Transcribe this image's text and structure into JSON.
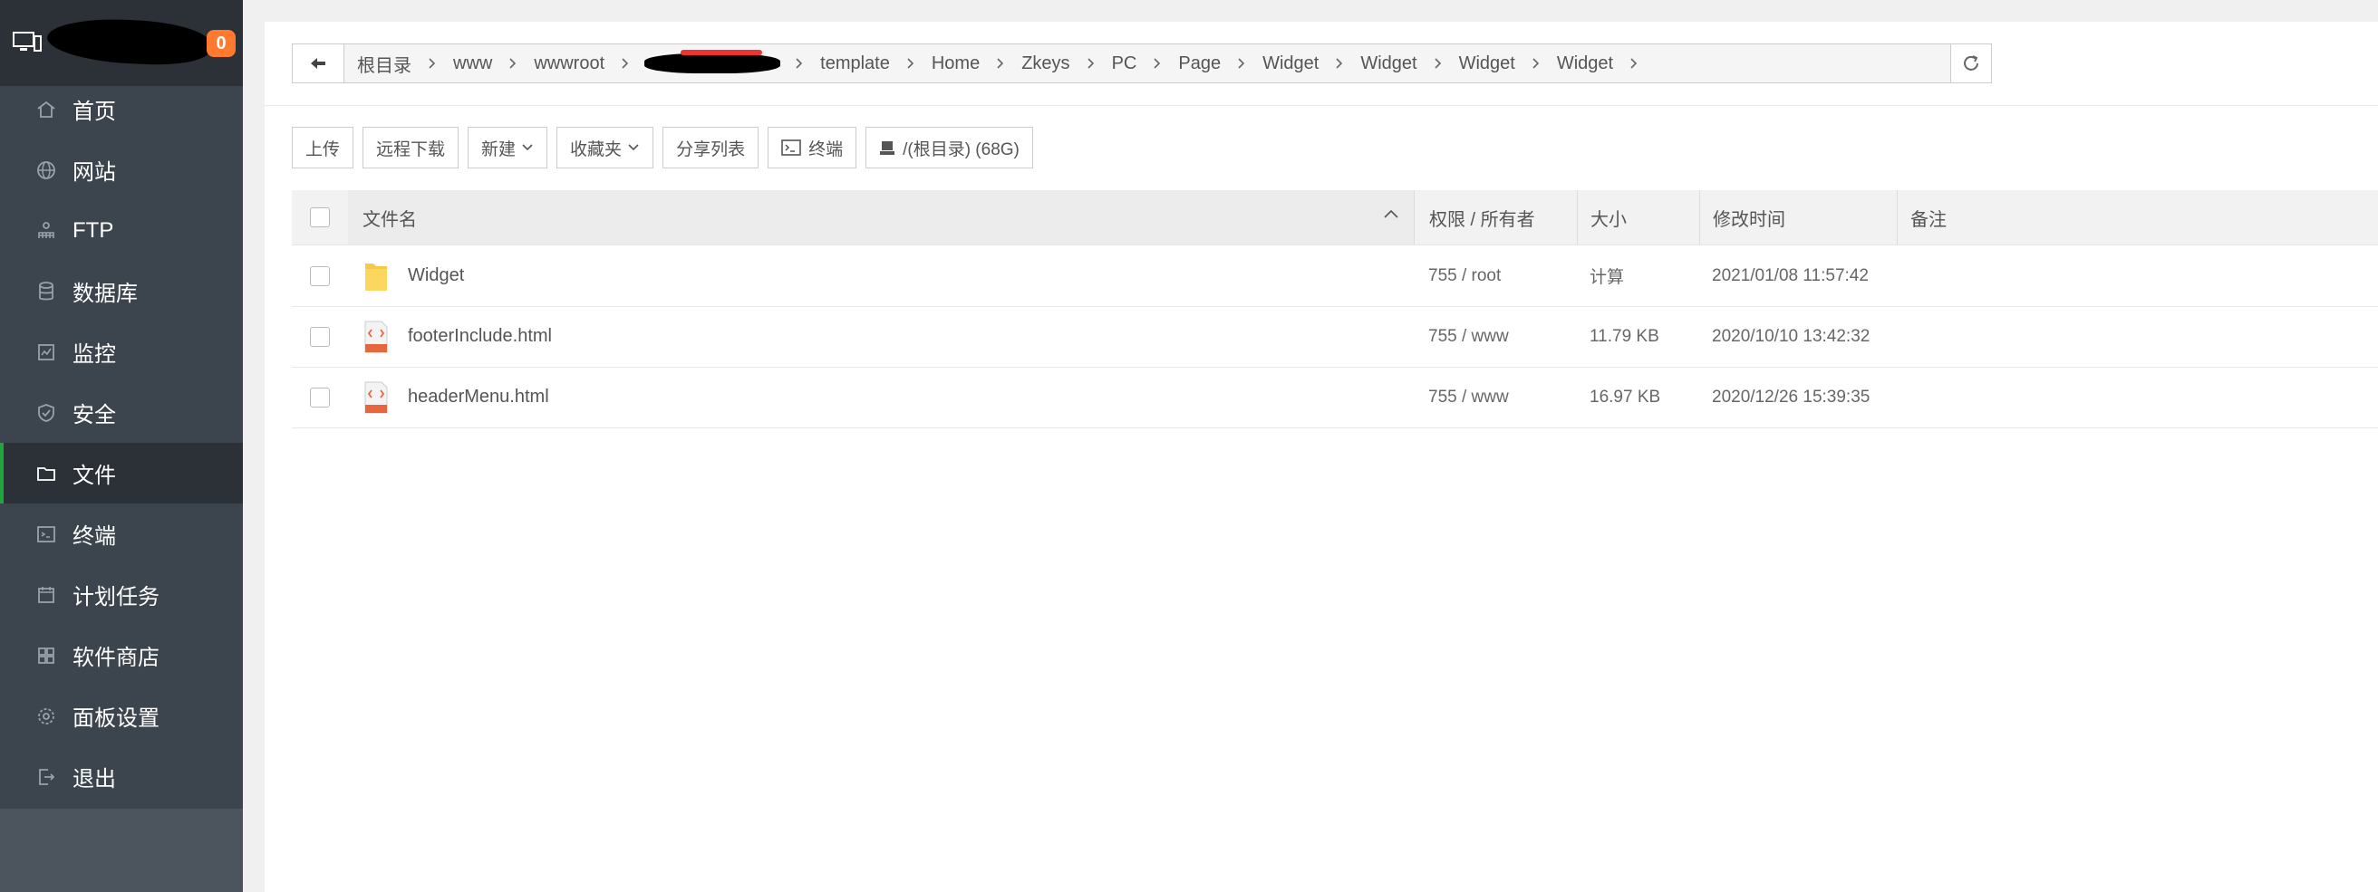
{
  "sidebar": {
    "badge": "0",
    "items": [
      {
        "label": "首页",
        "icon": "home-icon"
      },
      {
        "label": "网站",
        "icon": "globe-icon"
      },
      {
        "label": "FTP",
        "icon": "ftp-icon"
      },
      {
        "label": "数据库",
        "icon": "database-icon"
      },
      {
        "label": "监控",
        "icon": "monitor-icon"
      },
      {
        "label": "安全",
        "icon": "shield-icon"
      },
      {
        "label": "文件",
        "icon": "folder-icon"
      },
      {
        "label": "终端",
        "icon": "terminal-icon"
      },
      {
        "label": "计划任务",
        "icon": "calendar-icon"
      },
      {
        "label": "软件商店",
        "icon": "apps-icon"
      },
      {
        "label": "面板设置",
        "icon": "gear-icon"
      },
      {
        "label": "退出",
        "icon": "logout-icon"
      }
    ],
    "active_index": 6
  },
  "path": {
    "crumbs_before": [
      "根目录",
      "www",
      "wwwroot"
    ],
    "crumbs_after": [
      "template",
      "Home",
      "Zkeys",
      "PC",
      "Page",
      "Widget",
      "Widget",
      "Widget",
      "Widget"
    ]
  },
  "toolbar": {
    "upload": "上传",
    "remote_download": "远程下载",
    "new": "新建",
    "favorites": "收藏夹",
    "share_list": "分享列表",
    "terminal": "终端",
    "disk": "/(根目录) (68G)"
  },
  "table": {
    "headers": {
      "name": "文件名",
      "perm": "权限 / 所有者",
      "size": "大小",
      "mtime": "修改时间",
      "note": "备注"
    },
    "rows": [
      {
        "type": "folder",
        "name": "Widget",
        "perm": "755 / root",
        "size": "计算",
        "mtime": "2021/01/08 11:57:42"
      },
      {
        "type": "html",
        "name": "footerInclude.html",
        "perm": "755 / www",
        "size": "11.79 KB",
        "mtime": "2020/10/10 13:42:32"
      },
      {
        "type": "html",
        "name": "headerMenu.html",
        "perm": "755 / www",
        "size": "16.97 KB",
        "mtime": "2020/12/26 15:39:35"
      }
    ]
  },
  "colors": {
    "sidebar_bg": "#3c444d",
    "sidebar_active": "#2c3138",
    "accent_green": "#20a53a",
    "badge_orange": "#ff7a2e",
    "folder_yellow": "#f7c948",
    "html_orange": "#e8663d"
  }
}
